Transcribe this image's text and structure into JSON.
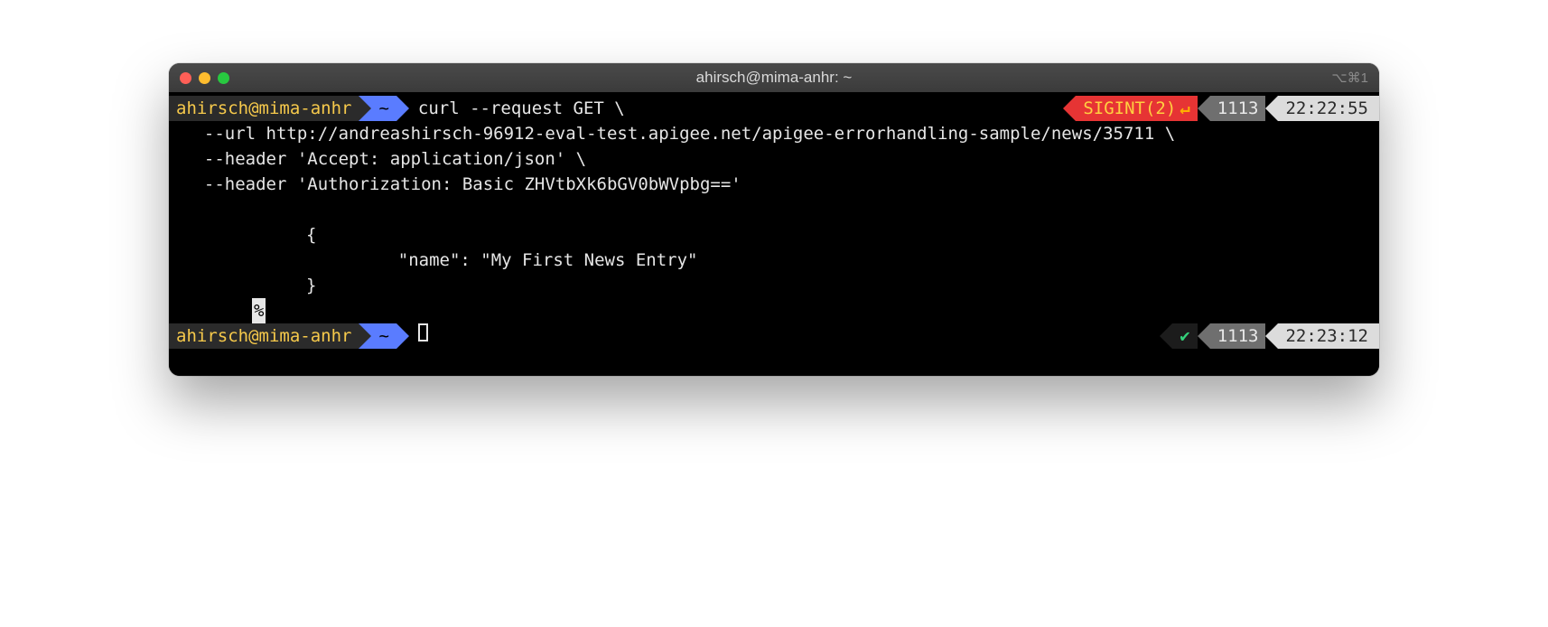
{
  "window": {
    "title": "ahirsch@mima-anhr: ~",
    "right_indicator": "⌥⌘1"
  },
  "prompt1": {
    "user_host": "ahirsch@mima-anhr",
    "dir": "~",
    "command_line1": "curl --request GET \\",
    "command_line2": "  --url http://andreashirsch-96912-eval-test.apigee.net/apigee-errorhandling-sample/news/35711 \\",
    "command_line3": "  --header 'Accept: application/json' \\",
    "command_line4": "  --header 'Authorization: Basic ZHVtbXk6bGV0bWVpbg=='",
    "status_signal": "SIGINT(2)",
    "status_arrow": "↵",
    "history": "1113",
    "time": "22:22:55"
  },
  "output": {
    "line1": "{",
    "line2": "    \"name\": \"My First News Entry\"",
    "line3": "}",
    "eol_marker": "%"
  },
  "prompt2": {
    "user_host": "ahirsch@mima-anhr",
    "dir": "~",
    "ok_mark": "✔",
    "history": "1113",
    "time": "22:23:12"
  }
}
